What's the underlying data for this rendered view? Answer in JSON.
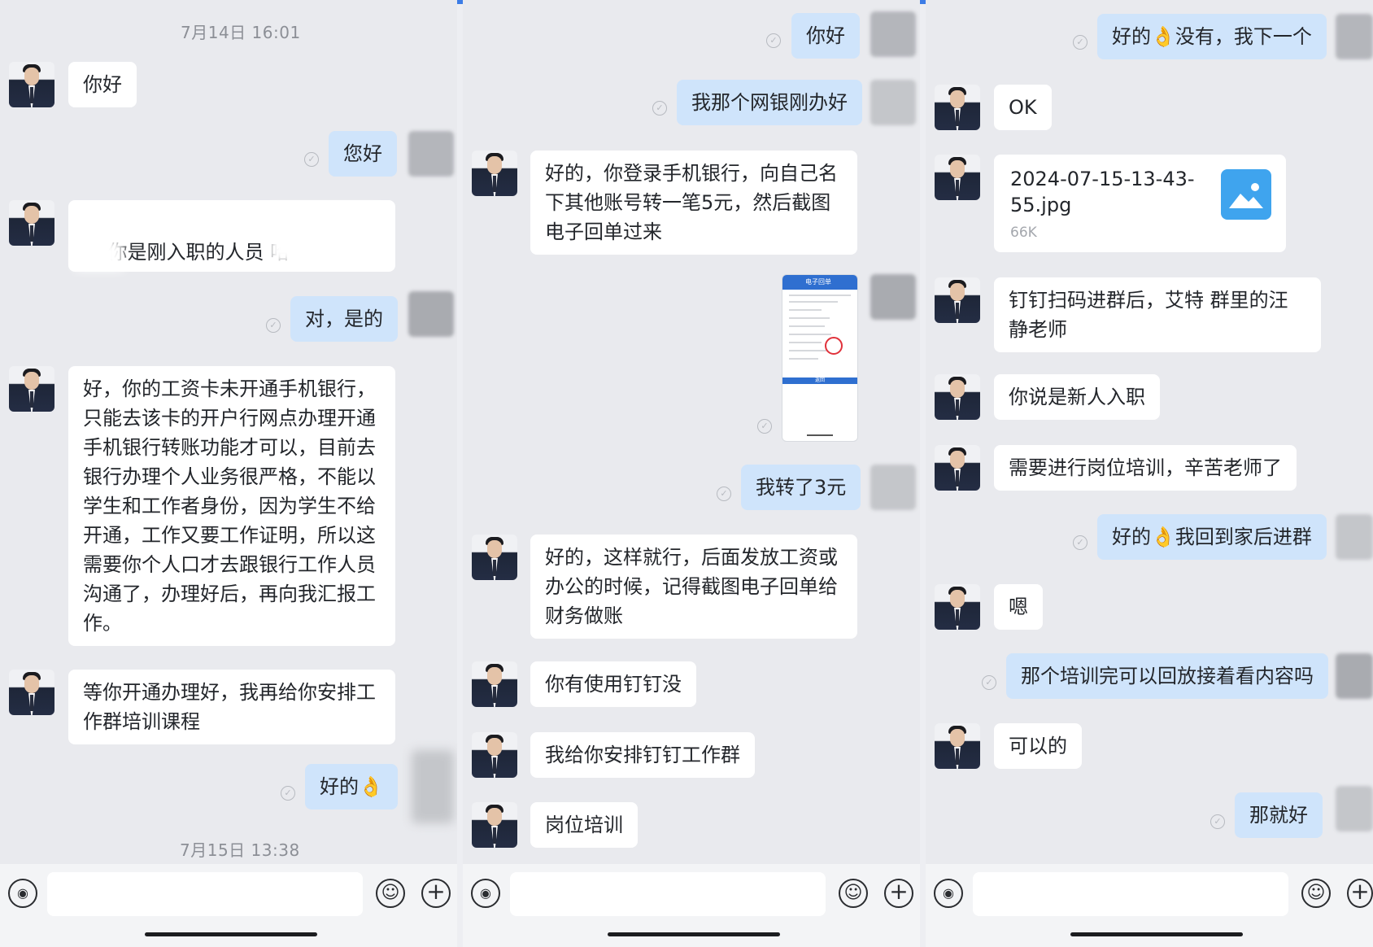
{
  "panel1": {
    "timestamp_top": "7月14日 16:01",
    "timestamp_bottom": "7月15日 13:38",
    "messages": [
      {
        "dir": "in",
        "text": "你好"
      },
      {
        "dir": "out",
        "text": "您好"
      },
      {
        "dir": "in",
        "text": "你是刚入职的人员 哈"
      },
      {
        "dir": "out",
        "text": "对，是的"
      },
      {
        "dir": "in",
        "text": "好，你的工资卡未开通手机银行，只能去该卡的开户行网点办理开通手机银行转账功能才可以，目前去银行办理个人业务很严格，不能以学生和工作者身份，因为学生不给开通，工作又要工作证明，所以这需要你个人口才去跟银行工作人员沟通了，办理好后，再向我汇报工作。"
      },
      {
        "dir": "in",
        "text": "等你开通办理好，我再给你安排工作群培训课程"
      },
      {
        "dir": "out",
        "text": "好的👌"
      }
    ]
  },
  "panel2": {
    "messages": [
      {
        "dir": "out",
        "text": "你好"
      },
      {
        "dir": "out",
        "text": "我那个网银刚办好"
      },
      {
        "dir": "in",
        "text": "好的，你登录手机银行，向自己名下其他账号转一笔5元，然后截图电子回单过来"
      },
      {
        "dir": "out",
        "image": "electronic-receipt-screenshot"
      },
      {
        "dir": "out",
        "text": "我转了3元"
      },
      {
        "dir": "in",
        "text": "好的，这样就行，后面发放工资或办公的时候，记得截图电子回单给财务做账"
      },
      {
        "dir": "in",
        "text": "你有使用钉钉没"
      },
      {
        "dir": "in",
        "text": "我给你安排钉钉工作群"
      },
      {
        "dir": "in",
        "text": "岗位培训"
      }
    ],
    "receipt_title": "电子回单",
    "receipt_button": "返回"
  },
  "panel3": {
    "messages": [
      {
        "dir": "out",
        "text": "好的👌没有，我下一个"
      },
      {
        "dir": "in",
        "text": "OK"
      },
      {
        "dir": "in",
        "file": {
          "name": "2024-07-15-13-43-55.jpg",
          "size": "66K",
          "icon": "image-file-icon"
        }
      },
      {
        "dir": "in",
        "text": "钉钉扫码进群后，艾特 群里的汪静老师"
      },
      {
        "dir": "in",
        "text": "你说是新人入职"
      },
      {
        "dir": "in",
        "text": "需要进行岗位培训，辛苦老师了"
      },
      {
        "dir": "out",
        "text": "好的👌我回到家后进群"
      },
      {
        "dir": "in",
        "text": "嗯"
      },
      {
        "dir": "out",
        "text": "那个培训完可以回放接着看内容吗"
      },
      {
        "dir": "in",
        "text": "可以的"
      },
      {
        "dir": "out",
        "text": "那就好"
      }
    ]
  },
  "inputbar": {
    "voice_icon": "voice-icon",
    "emoji_icon": "emoji-icon",
    "plus_icon": "plus-icon",
    "voice_glyph": "◉",
    "emoji_glyph": "☺",
    "plus_glyph": "+"
  },
  "colors": {
    "incoming_bubble": "#ffffff",
    "outgoing_bubble": "#cfe4fb",
    "background": "#e9eaee",
    "accent": "#3c7ce6"
  }
}
